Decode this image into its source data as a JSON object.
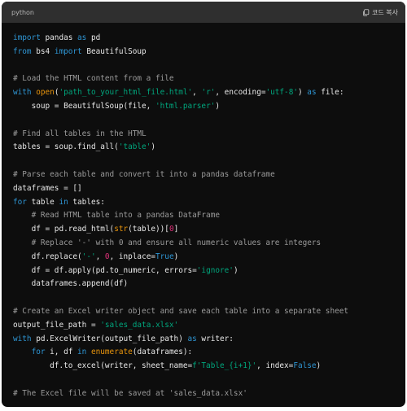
{
  "header": {
    "language": "python",
    "copy_label": "코드 복사"
  },
  "code_lines": [
    [
      [
        "kw",
        "import"
      ],
      [
        "txt",
        " pandas "
      ],
      [
        "kw",
        "as"
      ],
      [
        "txt",
        " pd"
      ]
    ],
    [
      [
        "kw",
        "from"
      ],
      [
        "txt",
        " bs4 "
      ],
      [
        "kw",
        "import"
      ],
      [
        "txt",
        " BeautifulSoup"
      ]
    ],
    [],
    [
      [
        "cm",
        "# Load the HTML content from a file"
      ]
    ],
    [
      [
        "kw",
        "with"
      ],
      [
        "txt",
        " "
      ],
      [
        "bi",
        "open"
      ],
      [
        "txt",
        "("
      ],
      [
        "str",
        "'path_to_your_html_file.html'"
      ],
      [
        "txt",
        ", "
      ],
      [
        "str",
        "'r'"
      ],
      [
        "txt",
        ", encoding="
      ],
      [
        "str",
        "'utf-8'"
      ],
      [
        "txt",
        ") "
      ],
      [
        "kw",
        "as"
      ],
      [
        "txt",
        " file:"
      ]
    ],
    [
      [
        "txt",
        "    soup = BeautifulSoup(file, "
      ],
      [
        "str",
        "'html.parser'"
      ],
      [
        "txt",
        ")"
      ]
    ],
    [],
    [
      [
        "cm",
        "# Find all tables in the HTML"
      ]
    ],
    [
      [
        "txt",
        "tables = soup.find_all("
      ],
      [
        "str",
        "'table'"
      ],
      [
        "txt",
        ")"
      ]
    ],
    [],
    [
      [
        "cm",
        "# Parse each table and convert it into a pandas dataframe"
      ]
    ],
    [
      [
        "txt",
        "dataframes = []"
      ]
    ],
    [
      [
        "kw",
        "for"
      ],
      [
        "txt",
        " table "
      ],
      [
        "kw",
        "in"
      ],
      [
        "txt",
        " tables:"
      ]
    ],
    [
      [
        "txt",
        "    "
      ],
      [
        "cm",
        "# Read HTML table into a pandas DataFrame"
      ]
    ],
    [
      [
        "txt",
        "    df = pd.read_html("
      ],
      [
        "bi",
        "str"
      ],
      [
        "txt",
        "(table))["
      ],
      [
        "num",
        "0"
      ],
      [
        "txt",
        "]"
      ]
    ],
    [
      [
        "txt",
        "    "
      ],
      [
        "cm",
        "# Replace '-' with 0 and ensure all numeric values are integers"
      ]
    ],
    [
      [
        "txt",
        "    df.replace("
      ],
      [
        "str",
        "'-'"
      ],
      [
        "txt",
        ", "
      ],
      [
        "num",
        "0"
      ],
      [
        "txt",
        ", inplace="
      ],
      [
        "kw",
        "True"
      ],
      [
        "txt",
        ")"
      ]
    ],
    [
      [
        "txt",
        "    df = df.apply(pd.to_numeric, errors="
      ],
      [
        "str",
        "'ignore'"
      ],
      [
        "txt",
        ")"
      ]
    ],
    [
      [
        "txt",
        "    dataframes.append(df)"
      ]
    ],
    [],
    [
      [
        "cm",
        "# Create an Excel writer object and save each table into a separate sheet"
      ]
    ],
    [
      [
        "txt",
        "output_file_path = "
      ],
      [
        "str",
        "'sales_data.xlsx'"
      ]
    ],
    [
      [
        "kw",
        "with"
      ],
      [
        "txt",
        " pd.ExcelWriter(output_file_path) "
      ],
      [
        "kw",
        "as"
      ],
      [
        "txt",
        " writer:"
      ]
    ],
    [
      [
        "txt",
        "    "
      ],
      [
        "kw",
        "for"
      ],
      [
        "txt",
        " i, df "
      ],
      [
        "kw",
        "in"
      ],
      [
        "txt",
        " "
      ],
      [
        "bi",
        "enumerate"
      ],
      [
        "txt",
        "(dataframes):"
      ]
    ],
    [
      [
        "txt",
        "        df.to_excel(writer, sheet_name="
      ],
      [
        "str",
        "f'Table_{i+1}'"
      ],
      [
        "txt",
        ", index="
      ],
      [
        "kw",
        "False"
      ],
      [
        "txt",
        ")"
      ]
    ],
    [],
    [
      [
        "cm",
        "# The Excel file will be saved at 'sales_data.xlsx'"
      ]
    ]
  ],
  "colors": {
    "background": "#0d0d0d",
    "header": "#2f2f2f",
    "keyword": "#2e95d3",
    "string": "#00a67d",
    "number": "#df3079",
    "comment": "#9b9b9b",
    "builtin": "#e9950c",
    "text": "#e8e8e8"
  },
  "icons": {
    "copy": "copy-icon"
  }
}
